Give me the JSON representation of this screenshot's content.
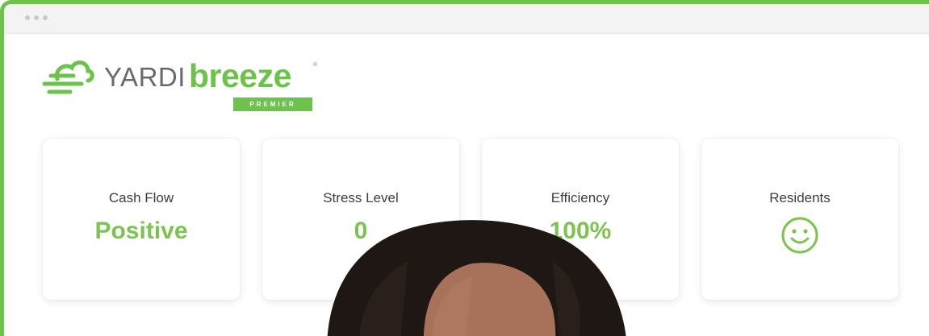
{
  "window": {
    "controls": [
      "dot",
      "dot",
      "dot"
    ]
  },
  "logo": {
    "brand": "YARDI",
    "product": "breeze",
    "registered": "®",
    "tier": "PREMIER"
  },
  "cards": [
    {
      "label": "Cash Flow",
      "value": "Positive"
    },
    {
      "label": "Stress Level",
      "value": "0"
    },
    {
      "label": "Efficiency",
      "value": "100%"
    },
    {
      "label": "Residents",
      "value": "",
      "icon": "smiley-face-icon"
    }
  ],
  "colors": {
    "accent": "#6cc24a",
    "value_green": "#7cc34f",
    "label_text": "#3d3d40",
    "titlebar_bg": "#f3f3f4",
    "hair": "#1e1714",
    "skin": "#a8715a"
  }
}
